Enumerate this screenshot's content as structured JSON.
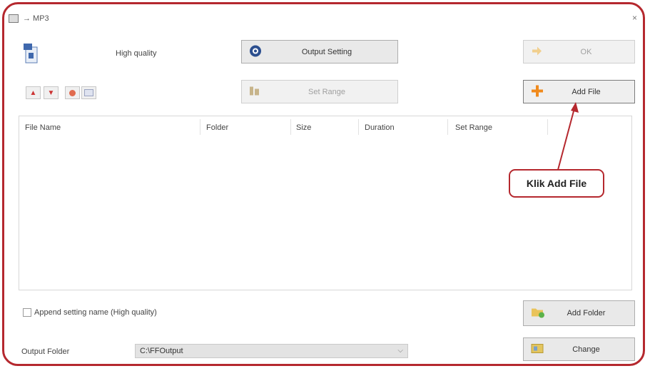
{
  "window": {
    "title": "→ MP3",
    "close_glyph": "×"
  },
  "profile": {
    "quality_label": "High quality"
  },
  "buttons": {
    "output_setting": "Output Setting",
    "ok": "OK",
    "set_range": "Set Range",
    "add_file": "Add File",
    "add_folder": "Add Folder",
    "change": "Change"
  },
  "list": {
    "columns": [
      "File Name",
      "Folder",
      "Size",
      "Duration",
      "Set Range"
    ]
  },
  "annotation": {
    "callout_text": "Klik Add File",
    "color": "#b5282e"
  },
  "options": {
    "append_setting_name": "Append setting name (High quality)",
    "append_checked": false
  },
  "output_folder": {
    "label": "Output Folder",
    "value": "C:\\FFOutput"
  },
  "toolbar_icons": [
    "move-up-icon",
    "move-down-icon",
    "remove-icon",
    "clear-icon"
  ]
}
